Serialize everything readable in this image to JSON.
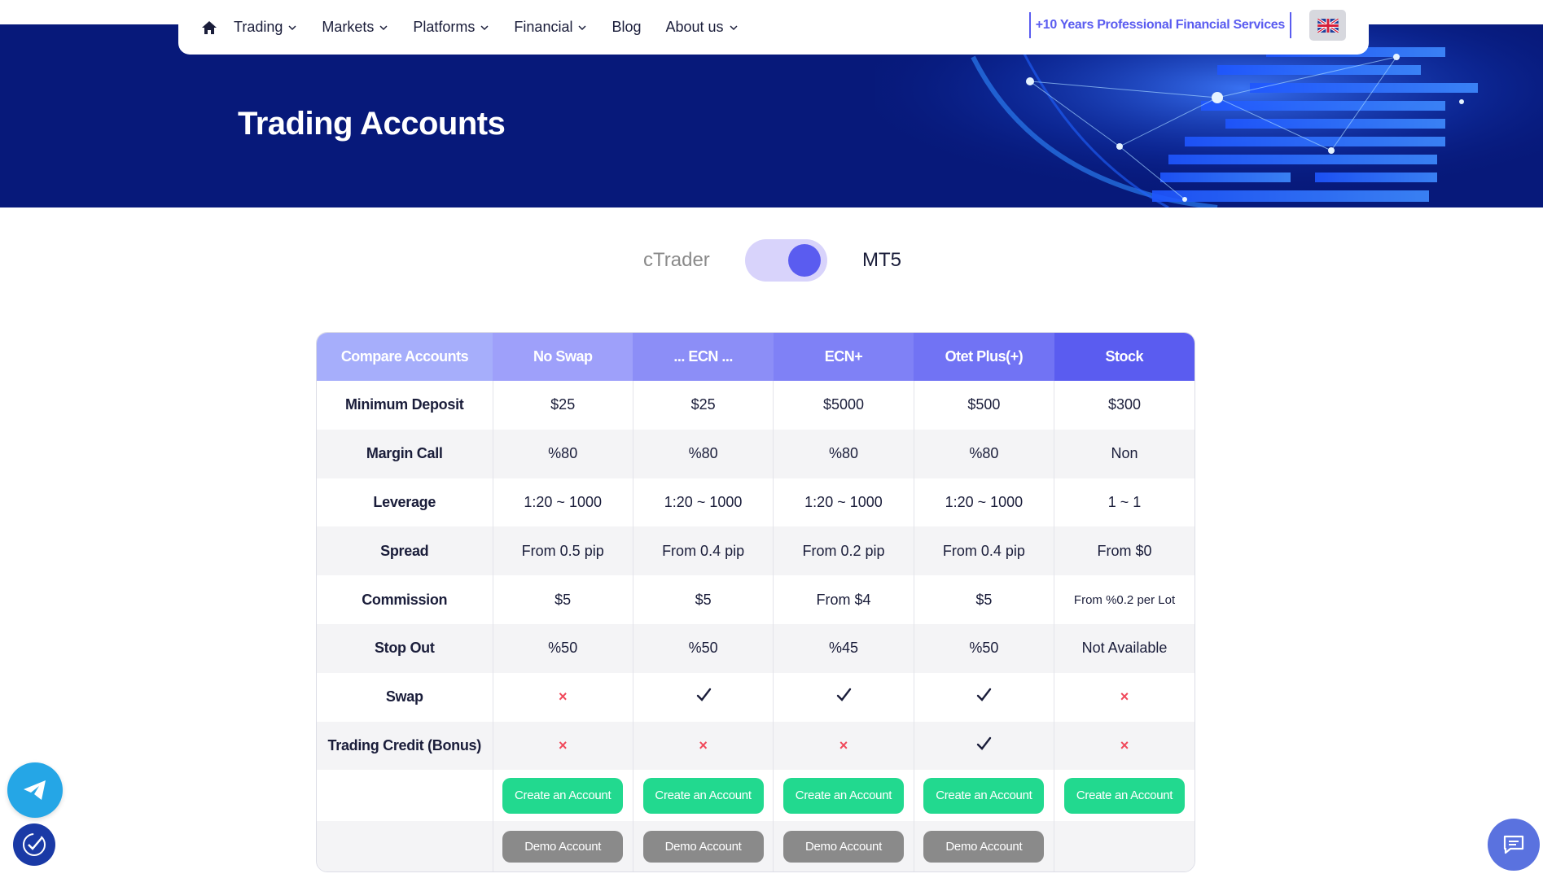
{
  "nav": {
    "items": [
      {
        "label": "Trading",
        "has_dropdown": true
      },
      {
        "label": "Markets",
        "has_dropdown": true
      },
      {
        "label": "Platforms",
        "has_dropdown": true
      },
      {
        "label": "Financial",
        "has_dropdown": true
      },
      {
        "label": "Blog",
        "has_dropdown": false
      },
      {
        "label": "About us",
        "has_dropdown": true
      }
    ],
    "tagline": "+10 Years Professional Financial Services",
    "language_icon": "uk-flag-icon"
  },
  "hero": {
    "title": "Trading Accounts"
  },
  "platform_toggle": {
    "left_label": "cTrader",
    "right_label": "MT5",
    "selected": "MT5"
  },
  "table": {
    "headers": [
      "Compare Accounts",
      "No Swap",
      "... ECN ...",
      "ECN+",
      "Otet Plus(+)",
      "Stock"
    ],
    "rows": [
      {
        "label": "Minimum Deposit",
        "values": [
          "$25",
          "$25",
          "$5000",
          "$500",
          "$300"
        ]
      },
      {
        "label": "Margin Call",
        "values": [
          "%80",
          "%80",
          "%80",
          "%80",
          "Non"
        ]
      },
      {
        "label": "Leverage",
        "values": [
          "1:20 ~ 1000",
          "1:20 ~ 1000",
          "1:20 ~ 1000",
          "1:20 ~ 1000",
          "1 ~ 1"
        ]
      },
      {
        "label": "Spread",
        "values": [
          "From 0.5 pip",
          "From 0.4 pip",
          "From 0.2 pip",
          "From 0.4 pip",
          "From $0"
        ]
      },
      {
        "label": "Commission",
        "values": [
          "$5",
          "$5",
          "From $4",
          "$5",
          "From %0.2 per Lot"
        ]
      },
      {
        "label": "Stop Out",
        "values": [
          "%50",
          "%50",
          "%45",
          "%50",
          "Not Available"
        ]
      },
      {
        "label": "Swap",
        "values": [
          "no",
          "yes",
          "yes",
          "yes",
          "no"
        ]
      },
      {
        "label": "Trading Credit (Bonus)",
        "values": [
          "no",
          "no",
          "no",
          "yes",
          "no"
        ]
      }
    ],
    "create_label": "Create an Account",
    "demo_label": "Demo Account",
    "cross_symbol": "×"
  },
  "colors": {
    "hero_bg": "#07197a",
    "accent": "#5a5cf0",
    "create_button": "#22d98f",
    "demo_button": "#8a8a8a",
    "cross": "#f0495b"
  },
  "floating": {
    "telegram": "telegram-icon",
    "accessibility": "accessibility-check-icon",
    "chat": "chat-icon"
  }
}
